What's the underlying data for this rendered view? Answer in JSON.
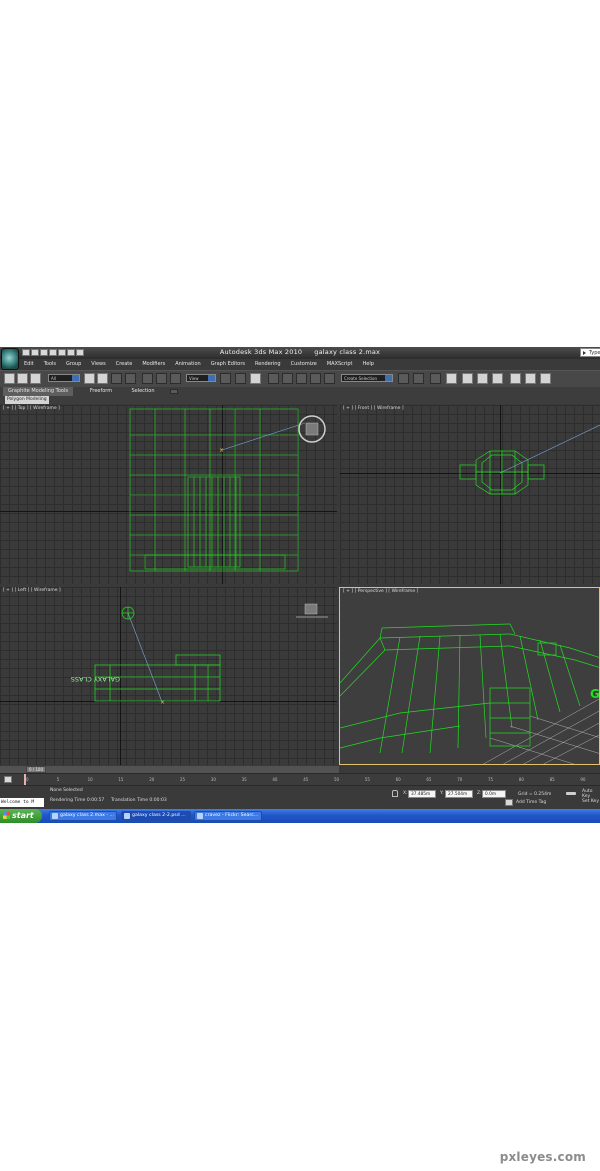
{
  "app": {
    "title": "Autodesk 3ds Max  2010",
    "file": "galaxy class 2.max",
    "search_placeholder": "Type"
  },
  "menu": [
    "Edit",
    "Tools",
    "Group",
    "Views",
    "Create",
    "Modifiers",
    "Animation",
    "Graph Editors",
    "Rendering",
    "Customize",
    "MAXScript",
    "Help"
  ],
  "toolbar": {
    "selection_filter": "All",
    "ref_coord": "View",
    "named_selection": "Create Selection"
  },
  "ribbon": {
    "tabs": [
      "Graphite Modeling Tools",
      "Freeform",
      "Selection"
    ],
    "panel_tab": "Polygon Modeling"
  },
  "viewports": {
    "top": "[ + ] [ Top ] [ Wireframe ]",
    "front": "[ + ] [ Front ] [ Wireframe ]",
    "left": "[ + ] [ Left ] [ Wireframe ]",
    "perspective": "[ + ] [ Perspective ] [ Wireframe ]",
    "model_text": "GALAXY CLASS",
    "persp_text": "GAL"
  },
  "timeline": {
    "frame": "0 / 100",
    "ticks": [
      "0",
      "5",
      "10",
      "15",
      "20",
      "25",
      "30",
      "35",
      "40",
      "45",
      "50",
      "55",
      "60",
      "65",
      "70",
      "75",
      "80",
      "85",
      "90"
    ],
    "active_frame_fraction": 0.0
  },
  "status": {
    "listener": "Welcome to M",
    "selection": "None Selected",
    "rendering_time": "Rendering Time  0:00:57",
    "translation_time": "Translation Time  0:00:03",
    "x_label": "X:",
    "x_value": "37.485m",
    "y_label": "Y:",
    "y_value": "27.504m",
    "z_label": "Z:",
    "z_value": "0.0m",
    "grid": "Grid = 0.254m",
    "add_time_tag": "Add Time Tag",
    "auto_key": "Auto Key",
    "set_key": "Set Key"
  },
  "taskbar": {
    "start": "start",
    "items": [
      "galaxy class 2.max - ...",
      "galaxy class 2-2.psd ...",
      "cravez - Flickr: Searc..."
    ]
  },
  "watermark": "pxleyes.com",
  "colors": {
    "wireframe": "#22dd22",
    "grid": "#2d2d2d",
    "viewport_bg": "#3a3a3a",
    "active_border": "#e0c36a",
    "taskbar": "#2156c7",
    "start": "#3a9e34"
  }
}
